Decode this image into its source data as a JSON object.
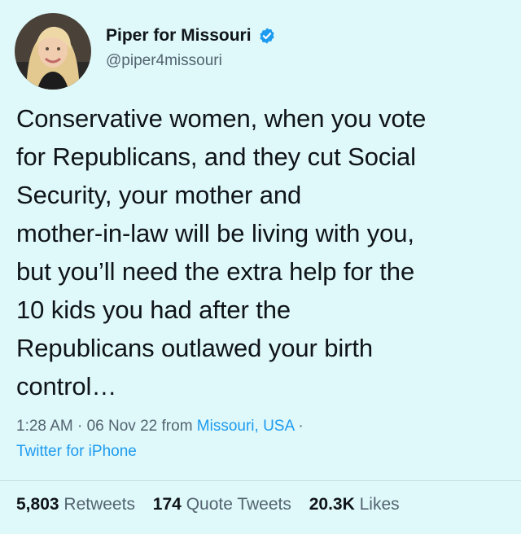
{
  "author": {
    "display_name": "Piper for Missouri",
    "handle": "@piper4missouri",
    "verified_icon": "verified-badge-icon"
  },
  "tweet": {
    "text": "Conservative women, when you vote\nfor Republicans, and they cut Social\nSecurity, your mother and\nmother-in-law will be living with you,\nbut you’ll need the extra help for the\n10 kids you had after the\nRepublicans outlawed your birth\ncontrol…"
  },
  "meta": {
    "time": "1:28 AM",
    "date": "06 Nov 22",
    "from_label": "from",
    "location": "Missouri, USA",
    "source": "Twitter for iPhone"
  },
  "stats": {
    "retweets_count": "5,803",
    "retweets_label": "Retweets",
    "quotes_count": "174",
    "quotes_label": "Quote Tweets",
    "likes_count": "20.3K",
    "likes_label": "Likes"
  },
  "colors": {
    "background": "#dff8f9",
    "link": "#1d9bf0",
    "verified": "#1d9bf0"
  }
}
